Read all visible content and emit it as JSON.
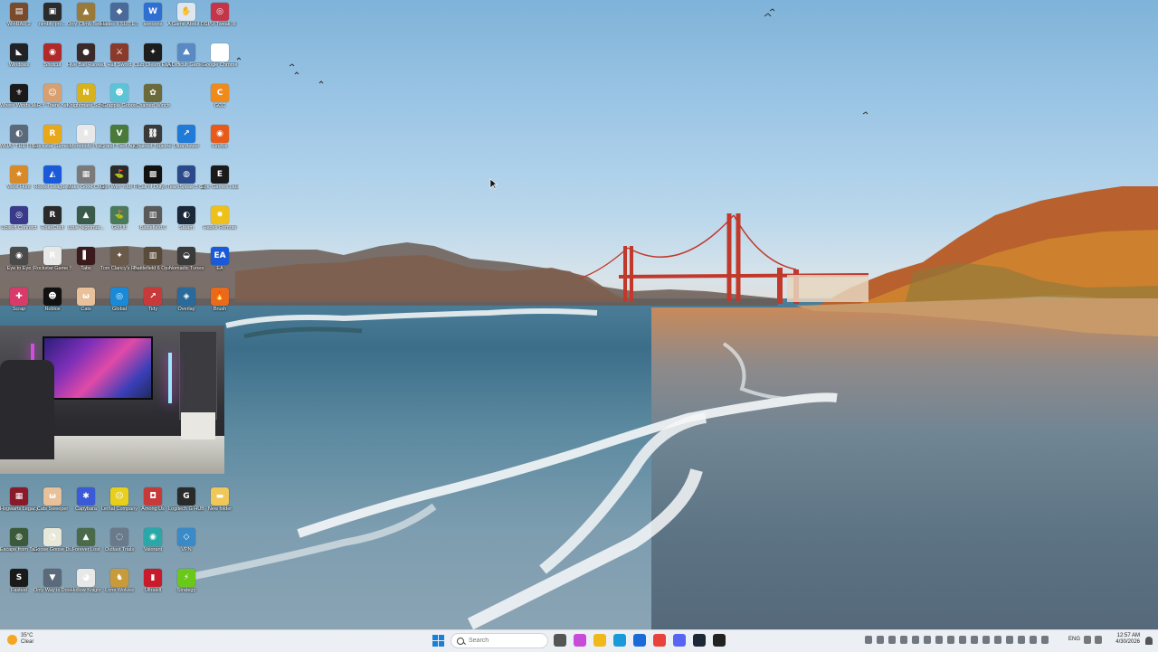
{
  "desktop_icons": [
    {
      "label": "WinRAR 2",
      "color": "#7a4a2c",
      "glyph": "▤"
    },
    {
      "label": "nimbfs pro...",
      "color": "#2b2b2b",
      "glyph": "▣"
    },
    {
      "label": "Only Climb Better Tog...",
      "color": "#9a7a3a",
      "glyph": "▲"
    },
    {
      "label": "Hades II SUITE SAP",
      "color": "#4a6a9a",
      "glyph": "◆"
    },
    {
      "label": "soncerie",
      "color": "#2f6fd1",
      "glyph": "W"
    },
    {
      "label": "A Game About D...",
      "color": "#dfe6ee",
      "glyph": "✋"
    },
    {
      "label": "GPU Tweak III",
      "color": "#c4354a",
      "glyph": "◎"
    },
    {
      "label": "Windows",
      "color": "#202225",
      "glyph": "◣"
    },
    {
      "label": "Shotcut",
      "color": "#b02a2a",
      "glyph": "◉"
    },
    {
      "label": "Hive Ball Ranked",
      "color": "#3a2a2a",
      "glyph": "●"
    },
    {
      "label": "Half Sword",
      "color": "#8a3a2a",
      "glyph": "⚔"
    },
    {
      "label": "Club Oleum Expedition 33",
      "color": "#1d1d1d",
      "glyph": "✦"
    },
    {
      "label": "A Difficult Game Abo...",
      "color": "#5a8ac4",
      "glyph": "⛰"
    },
    {
      "label": "Google Chrome",
      "color": "#ffffff",
      "glyph": "◎"
    },
    {
      "label": "Where Winds Meet",
      "color": "#1a1a1a",
      "glyph": "⚜"
    },
    {
      "label": "R.Y There Yet",
      "color": "#d8a070",
      "glyph": "☺"
    },
    {
      "label": "Knightmare Scheduler",
      "color": "#d8b21a",
      "glyph": "N"
    },
    {
      "label": "Grapple Gobos",
      "color": "#5cc4d6",
      "glyph": "☻"
    },
    {
      "label": "Chained Winch",
      "color": "#6a6a3a",
      "glyph": "✿"
    },
    {
      "label": "",
      "color": "transparent",
      "glyph": ""
    },
    {
      "label": "GCC",
      "color": "#f08a1a",
      "glyph": "C"
    },
    {
      "label": "WHAT THE FISH",
      "color": "#5a6a7a",
      "glyph": "◐"
    },
    {
      "label": "Rockstar Games...",
      "color": "#e8a81a",
      "glyph": "R"
    },
    {
      "label": "Monopoly Plus",
      "color": "#e8e8e8",
      "glyph": "♜"
    },
    {
      "label": "Grand Theft Auto V",
      "color": "#4a7a3a",
      "glyph": "V"
    },
    {
      "label": "Chained Together",
      "color": "#3a3a3a",
      "glyph": "⛓"
    },
    {
      "label": "UltraViewer",
      "color": "#1f7ad8",
      "glyph": "↗"
    },
    {
      "label": "Firefox",
      "color": "#e85a1a",
      "glyph": "◉"
    },
    {
      "label": "West Hunt",
      "color": "#d88a2a",
      "glyph": "★"
    },
    {
      "label": "Rocket League®",
      "color": "#1a5ad8",
      "glyph": "◭"
    },
    {
      "label": "Make Good Choices",
      "color": "#7a7a7a",
      "glyph": "▦"
    },
    {
      "label": "Golf With Your Friends",
      "color": "#2a2a2a",
      "glyph": "⛳"
    },
    {
      "label": "Call of Duty®",
      "color": "#111111",
      "glyph": "▩"
    },
    {
      "label": "TeamSpeak 3 Client",
      "color": "#2a4a8a",
      "glyph": "◍"
    },
    {
      "label": "Epic Games Launcher",
      "color": "#1a1a1a",
      "glyph": "E"
    },
    {
      "label": "Ubisoft Connect",
      "color": "#3a3a8a",
      "glyph": "◎"
    },
    {
      "label": "RoadCraft",
      "color": "#2a2a2a",
      "glyph": "R"
    },
    {
      "label": "Little Nightmar...",
      "color": "#3a5a4a",
      "glyph": "▲"
    },
    {
      "label": "Golf It!",
      "color": "#4a7a5a",
      "glyph": "⛳"
    },
    {
      "label": "Battlefield 6",
      "color": "#5a5a5a",
      "glyph": "▥"
    },
    {
      "label": "Steam",
      "color": "#1b2838",
      "glyph": "◐"
    },
    {
      "label": "Hades Remote",
      "color": "#f0c01a",
      "glyph": "✸"
    },
    {
      "label": "Eye to Eye",
      "color": "#4a4a4a",
      "glyph": "◉"
    },
    {
      "label": "Rockstar Game Services",
      "color": "#e8e8e8",
      "glyph": "R"
    },
    {
      "label": "Tabs",
      "color": "#3a1a1a",
      "glyph": "▌"
    },
    {
      "label": "Tom Clancy's Rainbow Six®",
      "color": "#6a5a4a",
      "glyph": "✦"
    },
    {
      "label": "Battlefield 6 Open Beta",
      "color": "#5a4a3a",
      "glyph": "▥"
    },
    {
      "label": "Nomadic Tunes",
      "color": "#3a3a3a",
      "glyph": "◒"
    },
    {
      "label": "EA",
      "color": "#1a5ad8",
      "glyph": "EA"
    },
    {
      "label": "Scrap",
      "color": "#d83a6a",
      "glyph": "✚"
    },
    {
      "label": "Roblox",
      "color": "#111111",
      "glyph": "☻"
    },
    {
      "label": "Cats",
      "color": "#e8c09a",
      "glyph": "ω"
    },
    {
      "label": "Global",
      "color": "#1a8ad8",
      "glyph": "◎"
    },
    {
      "label": "Tidy",
      "color": "#c83a3a",
      "glyph": "↗"
    },
    {
      "label": "Overlay",
      "color": "#2a6a9a",
      "glyph": "◈"
    },
    {
      "label": "Brush",
      "color": "#e86a1a",
      "glyph": "🔥"
    },
    {
      "label": "Hogwarts Legacy",
      "color": "#8a1a2a",
      "glyph": "▦"
    },
    {
      "label": "Cats Sweeper",
      "color": "#e8c09a",
      "glyph": "ω"
    },
    {
      "label": "Capybara",
      "color": "#3a5ad8",
      "glyph": "✱"
    },
    {
      "label": "Lethal Company",
      "color": "#e8d01a",
      "glyph": "☹"
    },
    {
      "label": "Among Us",
      "color": "#c83a3a",
      "glyph": "◘"
    },
    {
      "label": "Logitech G HUB",
      "color": "#2a2a2a",
      "glyph": "G"
    },
    {
      "label": "New folder",
      "color": "#f0c85a",
      "glyph": "▬"
    },
    {
      "label": "Escape from Tarkov",
      "color": "#3a5a3a",
      "glyph": "◍"
    },
    {
      "label": "Goose Goose Duck",
      "color": "#e8e8d8",
      "glyph": "◔"
    },
    {
      "label": "Forever Lost",
      "color": "#4a6a4a",
      "glyph": "▲"
    },
    {
      "label": "Outlast Trials",
      "color": "#6a7a8a",
      "glyph": "◌"
    },
    {
      "label": "Valorant",
      "color": "#2aa8a8",
      "glyph": "◉"
    },
    {
      "label": "VPN",
      "color": "#3a8ac8",
      "glyph": "◇"
    },
    {
      "label": "",
      "color": "transparent",
      "glyph": ""
    },
    {
      "label": "Fastest",
      "color": "#1a1a1a",
      "glyph": "S"
    },
    {
      "label": "Only Way is Down",
      "color": "#5a6a7a",
      "glyph": "▼"
    },
    {
      "label": "Hollow Knight",
      "color": "#e8e8e8",
      "glyph": "◕"
    },
    {
      "label": "Lone Wolves",
      "color": "#c89a3a",
      "glyph": "♞"
    },
    {
      "label": "Ultrakill",
      "color": "#c81a2a",
      "glyph": "▮"
    },
    {
      "label": "Strategy",
      "color": "#6ac81a",
      "glyph": "⚡"
    },
    {
      "label": "",
      "color": "transparent",
      "glyph": ""
    }
  ],
  "webcam": {
    "label": "webcam feed"
  },
  "taskbar": {
    "weather_temp": "35°C",
    "weather_cond": "Clear",
    "search_placeholder": "Search",
    "language": "ENG",
    "time": "12:57 AM",
    "date": "4/30/2026"
  },
  "taskbar_apps": [
    {
      "name": "task-view",
      "color": "#555"
    },
    {
      "name": "copilot",
      "color": "#c84ad8"
    },
    {
      "name": "file-explorer",
      "color": "#f0b81a"
    },
    {
      "name": "edge",
      "color": "#1a9ad8"
    },
    {
      "name": "store",
      "color": "#1a6ad8"
    },
    {
      "name": "chrome",
      "color": "#e8423a"
    },
    {
      "name": "discord",
      "color": "#5865f2"
    },
    {
      "name": "steam",
      "color": "#1b2838"
    },
    {
      "name": "epic",
      "color": "#222"
    }
  ]
}
